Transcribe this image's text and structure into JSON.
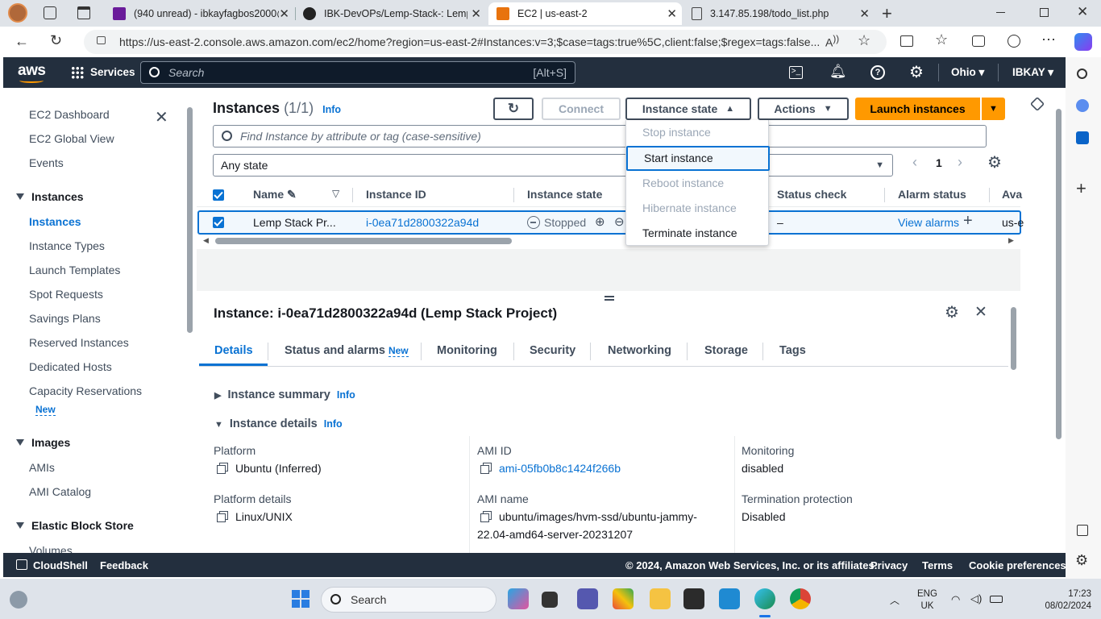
{
  "browser": {
    "tabs": [
      {
        "title": "(940 unread) - ibkayfagbos2000@",
        "active": false
      },
      {
        "title": "IBK-DevOPs/Lemp-Stack-: Lemp",
        "active": false
      },
      {
        "title": "EC2 | us-east-2",
        "active": true
      },
      {
        "title": "3.147.85.198/todo_list.php",
        "active": false
      }
    ],
    "url": "https://us-east-2.console.aws.amazon.com/ec2/home?region=us-east-2#Instances:v=3;$case=tags:true%5C,client:false;$regex=tags:false..."
  },
  "awsnav": {
    "logo": "aws",
    "services_label": "Services",
    "search_placeholder": "Search",
    "search_shortcut": "[Alt+S]",
    "region": "Ohio",
    "account": "IBKAY"
  },
  "sidebar": {
    "top_items": [
      "EC2 Dashboard",
      "EC2 Global View",
      "Events"
    ],
    "instances_heading": "Instances",
    "instances_items": [
      "Instances",
      "Instance Types",
      "Launch Templates",
      "Spot Requests",
      "Savings Plans",
      "Reserved Instances",
      "Dedicated Hosts",
      "Capacity Reservations"
    ],
    "new_badge": "New",
    "images_heading": "Images",
    "images_items": [
      "AMIs",
      "AMI Catalog"
    ],
    "ebs_heading": "Elastic Block Store",
    "ebs_items": [
      "Volumes"
    ]
  },
  "instances": {
    "title": "Instances",
    "count": "(1/1)",
    "info": "Info",
    "connect_label": "Connect",
    "instance_state_label": "Instance state",
    "actions_label": "Actions",
    "launch_label": "Launch instances",
    "filter_placeholder": "Find Instance by attribute or tag (case-sensitive)",
    "state_filter": "Any state",
    "page": "1",
    "columns": [
      "Name",
      "Instance ID",
      "Instance state",
      "Status check",
      "Alarm status",
      "Ava"
    ],
    "row": {
      "name": "Lemp Stack Pr...",
      "id": "i-0ea71d2800322a94d",
      "state": "Stopped",
      "status_check": "–",
      "alarm": "View alarms",
      "az": "us-e"
    }
  },
  "state_menu": {
    "items": [
      {
        "label": "Stop instance",
        "enabled": false
      },
      {
        "label": "Start instance",
        "enabled": true
      },
      {
        "label": "Reboot instance",
        "enabled": false
      },
      {
        "label": "Hibernate instance",
        "enabled": false
      },
      {
        "label": "Terminate instance",
        "enabled": true
      }
    ]
  },
  "details": {
    "title": "Instance: i-0ea71d2800322a94d (Lemp Stack Project)",
    "tabs": [
      "Details",
      "Status and alarms",
      "Monitoring",
      "Security",
      "Networking",
      "Storage",
      "Tags"
    ],
    "new_badge": "New",
    "summary_label": "Instance summary",
    "details_label": "Instance details",
    "info": "Info",
    "fields": {
      "platform_label": "Platform",
      "platform_value": "Ubuntu (Inferred)",
      "platform_details_label": "Platform details",
      "platform_details_value": "Linux/UNIX",
      "ami_id_label": "AMI ID",
      "ami_id_value": "ami-05fb0b8c1424f266b",
      "ami_name_label": "AMI name",
      "ami_name_line1": "ubuntu/images/hvm-ssd/ubuntu-jammy-",
      "ami_name_line2": "22.04-amd64-server-20231207",
      "monitoring_label": "Monitoring",
      "monitoring_value": "disabled",
      "termination_label": "Termination protection",
      "termination_value": "Disabled"
    }
  },
  "footer": {
    "cloudshell": "CloudShell",
    "feedback": "Feedback",
    "copyright": "© 2024, Amazon Web Services, Inc. or its affiliates.",
    "privacy": "Privacy",
    "terms": "Terms",
    "cookies": "Cookie preferences"
  },
  "taskbar": {
    "search": "Search",
    "lang1": "ENG",
    "lang2": "UK",
    "time": "17:23",
    "date": "08/02/2024"
  },
  "colors": {
    "aws_nav": "#232f3e",
    "primary_orange": "#ff9900",
    "link_blue": "#0972d3"
  }
}
